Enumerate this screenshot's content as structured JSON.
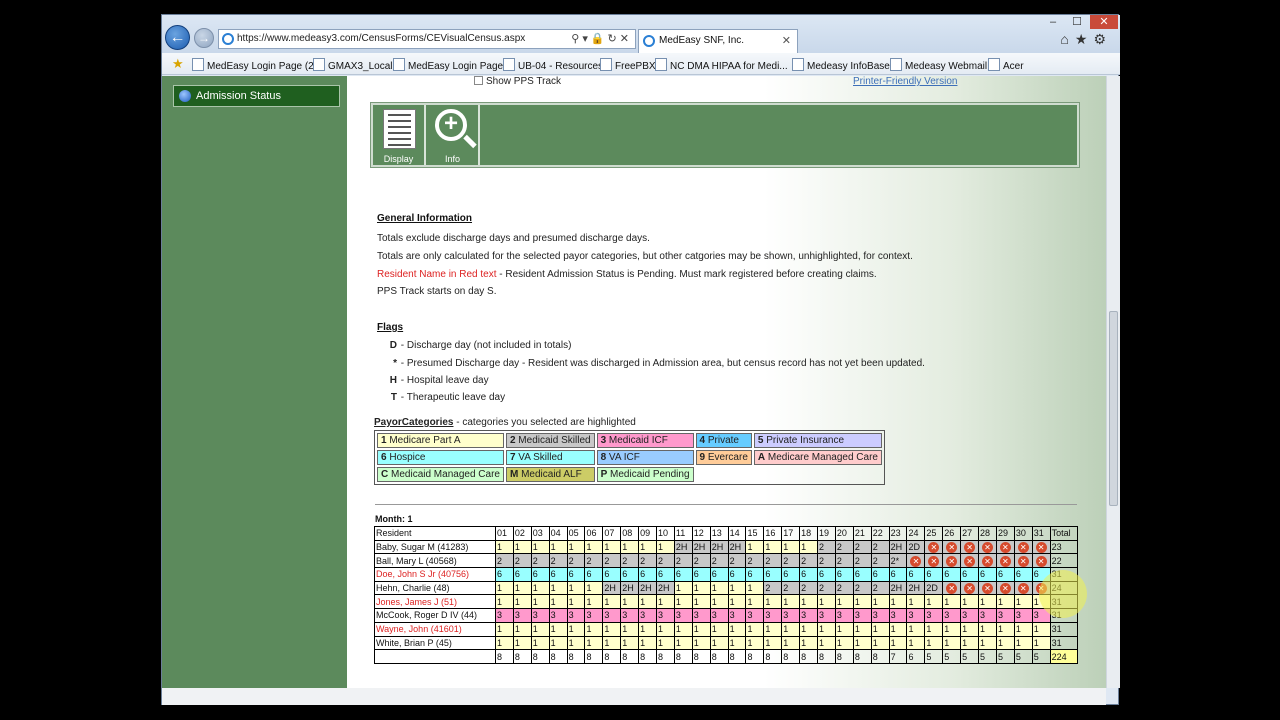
{
  "browser": {
    "url": "https://www.medeasy3.com/CensusForms/CEVisualCensus.aspx",
    "tab_title": "MedEasy SNF, Inc.",
    "window_controls": [
      "–",
      "☐",
      "✕"
    ],
    "favorites": [
      "MedEasy Login Page (2)",
      "GMAX3_Local",
      "MedEasy Login Page",
      "UB-04 - Resources",
      "FreePBX",
      "NC DMA HIPAA for Medi...",
      "Medeasy InfoBase",
      "Medeasy Webmail",
      "Acer"
    ]
  },
  "sidebar": {
    "admission_status": "Admission Status"
  },
  "page": {
    "show_pps_track": "Show PPS Track",
    "printer_friendly": "Printer-Friendly Version",
    "toolbar": {
      "display": "Display",
      "info": "Info"
    },
    "general": {
      "heading": "General Information",
      "line1": "Totals exclude discharge days and presumed discharge days.",
      "line2": "Totals are only calculated for the selected payor categories, but other catgories may be shown, unhighlighted, for context.",
      "line3_red": "Resident Name in Red text",
      "line3_rest": " - Resident Admission Status is Pending. Must mark registered before creating claims.",
      "line4": "PPS Track starts on day S."
    },
    "flags": {
      "heading": "Flags",
      "items": [
        {
          "key": "D",
          "text": " - Discharge day (not included in totals)"
        },
        {
          "key": "*",
          "text": " - Presumed Discharge day - Resident was discharged in Admission area, but census record has not yet been updated."
        },
        {
          "key": "H",
          "text": " - Hospital leave day"
        },
        {
          "key": "T",
          "text": " - Therapeutic leave day"
        }
      ]
    },
    "payor": {
      "title": "PayorCategories",
      "subtitle": " - categories you selected are highlighted",
      "rows": [
        [
          {
            "code": "1",
            "name": "Medicare Part A",
            "color": "#ffffcc"
          },
          {
            "code": "2",
            "name": "Medicaid Skilled",
            "color": "#c8c8c8"
          },
          {
            "code": "3",
            "name": "Medicaid ICF",
            "color": "#ff99cc"
          },
          {
            "code": "4",
            "name": "Private",
            "color": "#66ccff"
          },
          {
            "code": "5",
            "name": "Private Insurance",
            "color": "#ccccff"
          }
        ],
        [
          {
            "code": "6",
            "name": "Hospice",
            "color": "#99ffff"
          },
          {
            "code": "7",
            "name": "VA Skilled",
            "color": "#99ffff"
          },
          {
            "code": "8",
            "name": "VA ICF",
            "color": "#99ccff"
          },
          {
            "code": "9",
            "name": "Evercare",
            "color": "#ffcc99"
          },
          {
            "code": "A",
            "name": "Medicare Managed Care",
            "color": "#ffcccc"
          }
        ],
        [
          {
            "code": "C",
            "name": "Medicaid Managed Care",
            "color": "#ccffcc"
          },
          {
            "code": "M",
            "name": "Medicaid ALF",
            "color": "#cccc66"
          },
          {
            "code": "P",
            "name": "Medicaid Pending",
            "color": "#ccffcc"
          }
        ]
      ]
    },
    "census": {
      "month_label": "Month: 1",
      "header_resident": "Resident",
      "header_total": "Total",
      "days": [
        "01",
        "02",
        "03",
        "04",
        "05",
        "06",
        "07",
        "08",
        "09",
        "10",
        "11",
        "12",
        "13",
        "14",
        "15",
        "16",
        "17",
        "18",
        "19",
        "20",
        "21",
        "22",
        "23",
        "24",
        "25",
        "26",
        "27",
        "28",
        "29",
        "30",
        "31"
      ],
      "rows": [
        {
          "name": "Baby, Sugar M (41283)",
          "pending": false,
          "cells": [
            "1",
            "1",
            "1",
            "1",
            "1",
            "1",
            "1",
            "1",
            "1",
            "1",
            "2H",
            "2H",
            "2H",
            "2H",
            "1",
            "1",
            "1",
            "1",
            "2",
            "2",
            "2",
            "2",
            "2H",
            "2D",
            "X",
            "X",
            "X",
            "X",
            "X",
            "X",
            "X"
          ],
          "total": "23"
        },
        {
          "name": "Ball, Mary L (40568)",
          "pending": false,
          "cells": [
            "2",
            "2",
            "2",
            "2",
            "2",
            "2",
            "2",
            "2",
            "2",
            "2",
            "2",
            "2",
            "2",
            "2",
            "2",
            "2",
            "2",
            "2",
            "2",
            "2",
            "2",
            "2",
            "2*",
            "X",
            "X",
            "X",
            "X",
            "X",
            "X",
            "X",
            "X"
          ],
          "total": "22"
        },
        {
          "name": "Doe, John S Jr (40756)",
          "pending": true,
          "cells": [
            "6",
            "6",
            "6",
            "6",
            "6",
            "6",
            "6",
            "6",
            "6",
            "6",
            "6",
            "6",
            "6",
            "6",
            "6",
            "6",
            "6",
            "6",
            "6",
            "6",
            "6",
            "6",
            "6",
            "6",
            "6",
            "6",
            "6",
            "6",
            "6",
            "6",
            "6"
          ],
          "total": "31"
        },
        {
          "name": "Hehn, Charlie (48)",
          "pending": false,
          "cells": [
            "1",
            "1",
            "1",
            "1",
            "1",
            "1",
            "2H",
            "2H",
            "2H",
            "2H",
            "1",
            "1",
            "1",
            "1",
            "1",
            "2",
            "2",
            "2",
            "2",
            "2",
            "2",
            "2",
            "2H",
            "2H",
            "2D",
            "X",
            "X",
            "X",
            "X",
            "X",
            "X"
          ],
          "total": "24"
        },
        {
          "name": "Jones, James J (51)",
          "pending": true,
          "cells": [
            "1",
            "1",
            "1",
            "1",
            "1",
            "1",
            "1",
            "1",
            "1",
            "1",
            "1",
            "1",
            "1",
            "1",
            "1",
            "1",
            "1",
            "1",
            "1",
            "1",
            "1",
            "1",
            "1",
            "1",
            "1",
            "1",
            "1",
            "1",
            "1",
            "1",
            "1"
          ],
          "total": "31"
        },
        {
          "name": "McCook, Roger D IV (44)",
          "pending": false,
          "cells": [
            "3",
            "3",
            "3",
            "3",
            "3",
            "3",
            "3",
            "3",
            "3",
            "3",
            "3",
            "3",
            "3",
            "3",
            "3",
            "3",
            "3",
            "3",
            "3",
            "3",
            "3",
            "3",
            "3",
            "3",
            "3",
            "3",
            "3",
            "3",
            "3",
            "3",
            "3"
          ],
          "total": "31"
        },
        {
          "name": "Wayne, John (41601)",
          "pending": true,
          "cells": [
            "1",
            "1",
            "1",
            "1",
            "1",
            "1",
            "1",
            "1",
            "1",
            "1",
            "1",
            "1",
            "1",
            "1",
            "1",
            "1",
            "1",
            "1",
            "1",
            "1",
            "1",
            "1",
            "1",
            "1",
            "1",
            "1",
            "1",
            "1",
            "1",
            "1",
            "1"
          ],
          "total": "31"
        },
        {
          "name": "White, Brian P (45)",
          "pending": false,
          "cells": [
            "1",
            "1",
            "1",
            "1",
            "1",
            "1",
            "1",
            "1",
            "1",
            "1",
            "1",
            "1",
            "1",
            "1",
            "1",
            "1",
            "1",
            "1",
            "1",
            "1",
            "1",
            "1",
            "1",
            "1",
            "1",
            "1",
            "1",
            "1",
            "1",
            "1",
            "1"
          ],
          "total": "31"
        }
      ],
      "daily_totals": [
        "8",
        "8",
        "8",
        "8",
        "8",
        "8",
        "8",
        "8",
        "8",
        "8",
        "8",
        "8",
        "8",
        "8",
        "8",
        "8",
        "8",
        "8",
        "8",
        "8",
        "8",
        "8",
        "7",
        "6",
        "5",
        "5",
        "5",
        "5",
        "5",
        "5",
        "5"
      ],
      "grand_total": "224"
    }
  }
}
